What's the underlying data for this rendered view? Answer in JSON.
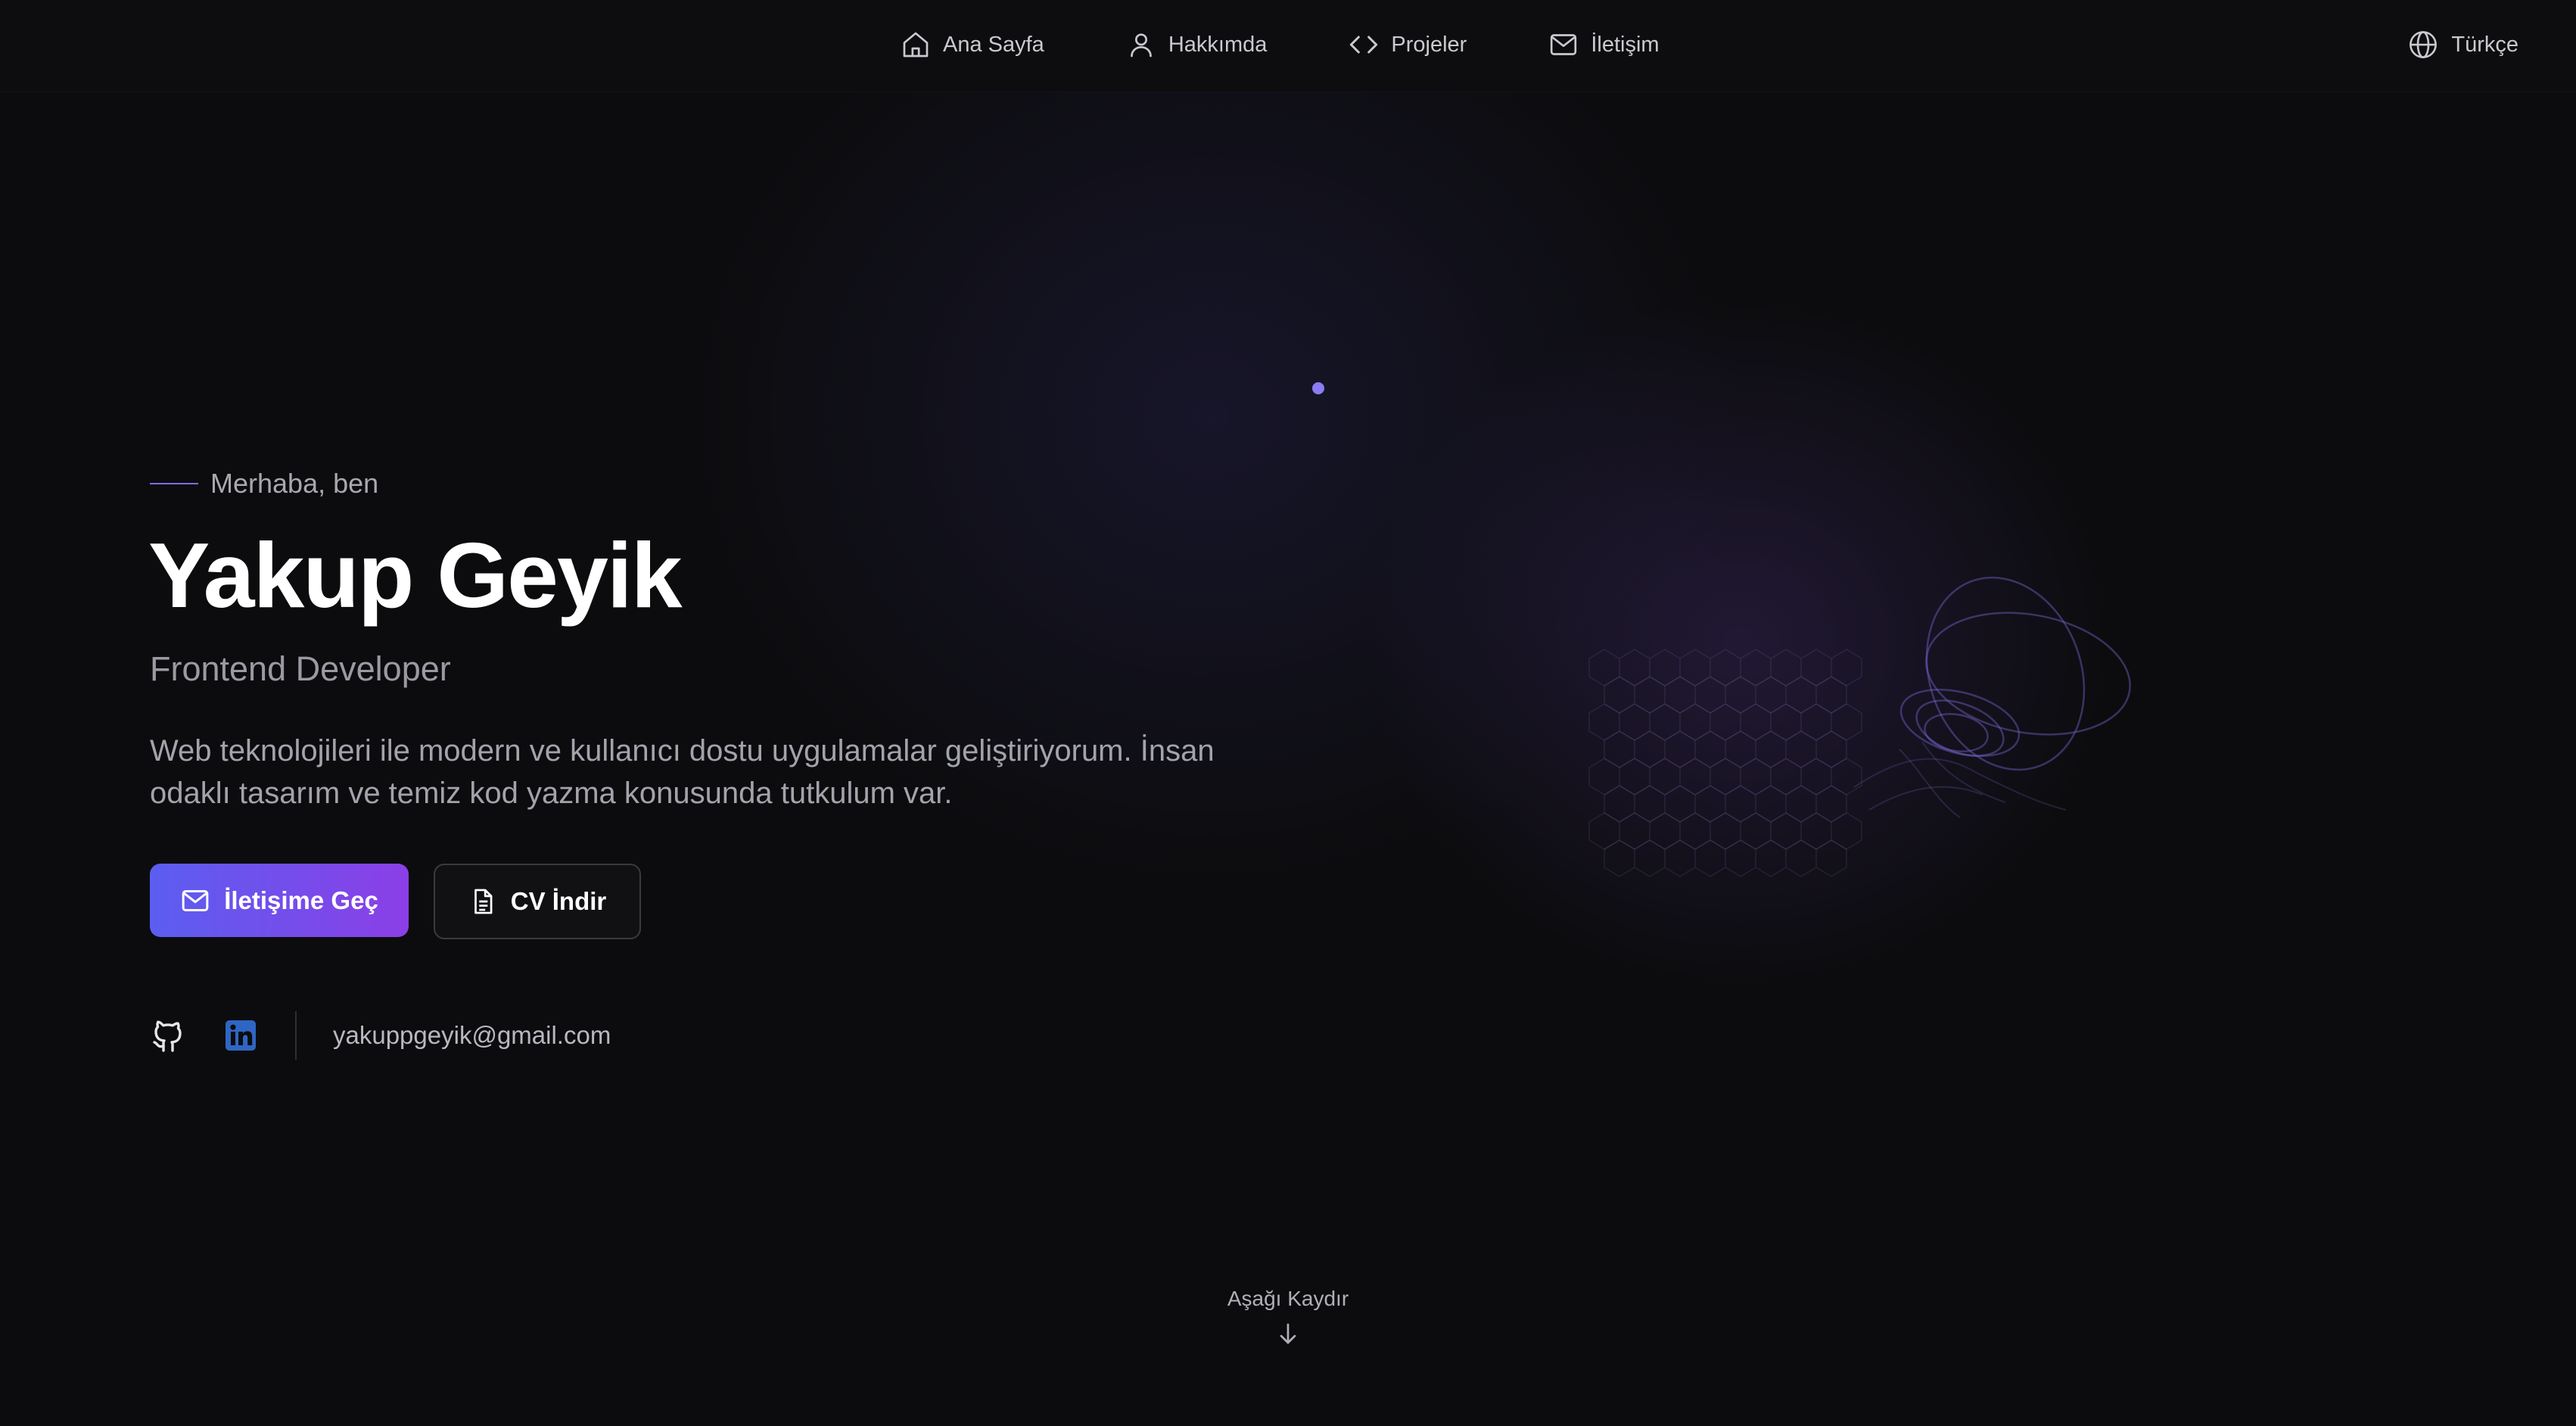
{
  "nav": {
    "items": [
      {
        "label": "Ana Sayfa",
        "icon": "home-icon"
      },
      {
        "label": "Hakkımda",
        "icon": "user-icon"
      },
      {
        "label": "Projeler",
        "icon": "code-icon"
      },
      {
        "label": "İletişim",
        "icon": "mail-icon"
      }
    ],
    "language": {
      "label": "Türkçe",
      "icon": "globe-icon"
    }
  },
  "hero": {
    "greeting": "Merhaba, ben",
    "name": "Yakup Geyik",
    "role": "Frontend Developer",
    "description": "Web teknolojileri ile modern ve kullanıcı dostu uygulamalar geliştiriyorum. İnsan odaklı tasarım ve temiz kod yazma konusunda tutkulum var.",
    "primary_button": "İletişime Geç",
    "secondary_button": "CV İndir",
    "email": "yakuppgeyik@gmail.com",
    "socials": [
      {
        "icon": "github-icon"
      },
      {
        "icon": "linkedin-icon"
      }
    ]
  },
  "scroll_hint": "Aşağı Kaydır",
  "colors": {
    "background": "#0c0c0e",
    "accent_start": "#5b5ef0",
    "accent_end": "#8b3fe6",
    "linkedin": "#2f66c4"
  }
}
